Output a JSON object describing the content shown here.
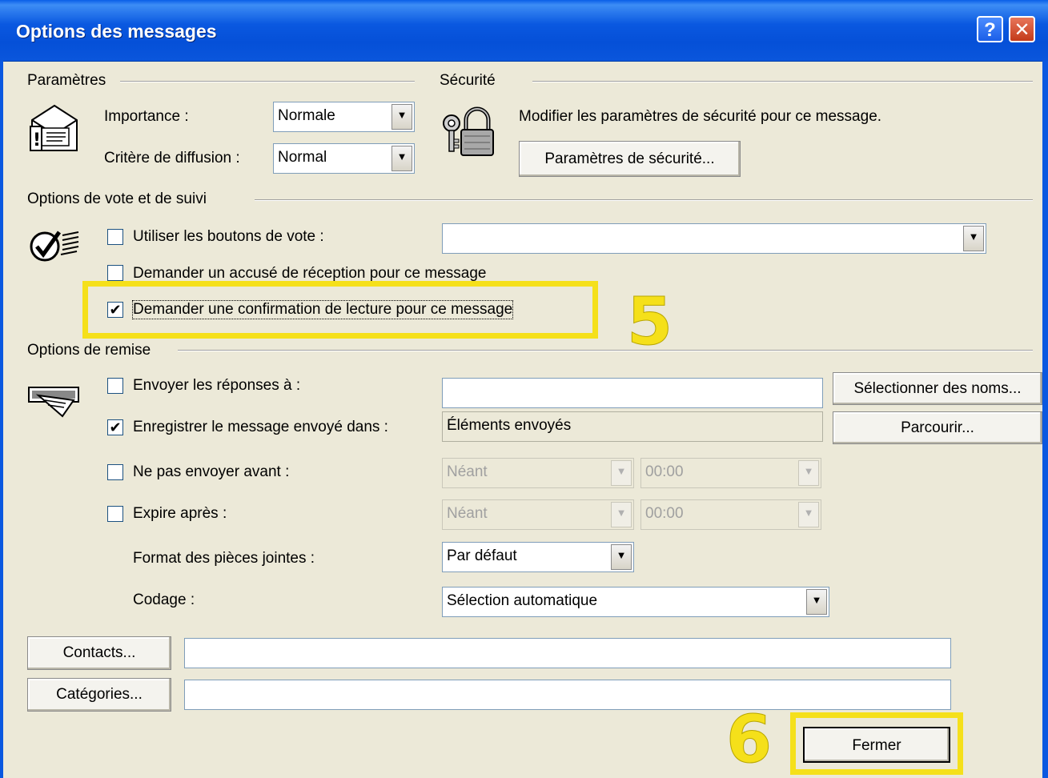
{
  "window": {
    "title": "Options des messages",
    "help_glyph": "?",
    "close_glyph": "✕"
  },
  "parametres": {
    "heading": "Paramètres",
    "importance_label": "Importance :",
    "importance_value": "Normale",
    "diffusion_label": "Critère de diffusion :",
    "diffusion_value": "Normal"
  },
  "securite": {
    "heading": "Sécurité",
    "description": "Modifier les paramètres de sécurité pour ce message.",
    "button_label": "Paramètres de sécurité..."
  },
  "vote": {
    "heading": "Options de vote et de suivi",
    "vote_buttons_label": "Utiliser les boutons de vote :",
    "vote_buttons_checked": false,
    "vote_buttons_value": "",
    "receipt_label": "Demander un accusé de réception pour ce message",
    "receipt_checked": false,
    "read_confirm_label": "Demander une confirmation de lecture pour ce message",
    "read_confirm_checked": true
  },
  "remise": {
    "heading": "Options de remise",
    "replies_label": "Envoyer les réponses à :",
    "replies_checked": false,
    "replies_value": "",
    "select_names_button": "Sélectionner des noms...",
    "save_label": "Enregistrer le message envoyé dans :",
    "save_checked": true,
    "save_value": "Éléments envoyés",
    "browse_button": "Parcourir...",
    "not_before_label": "Ne pas envoyer avant :",
    "not_before_checked": false,
    "not_before_date": "Néant",
    "not_before_time": "00:00",
    "expires_label": "Expire après :",
    "expires_checked": false,
    "expires_date": "Néant",
    "expires_time": "00:00",
    "attachment_format_label": "Format des pièces jointes :",
    "attachment_format_value": "Par défaut",
    "encoding_label": "Codage :",
    "encoding_value": "Sélection automatique"
  },
  "footer": {
    "contacts_button": "Contacts...",
    "contacts_value": "",
    "categories_button": "Catégories...",
    "categories_value": "",
    "close_button": "Fermer"
  },
  "annotations": {
    "step5": "5",
    "step6": "6",
    "highlight_color": "#F5E01A"
  },
  "colors": {
    "dialog_bg": "#ECE9D8",
    "titlebar": "#0A58E0"
  }
}
